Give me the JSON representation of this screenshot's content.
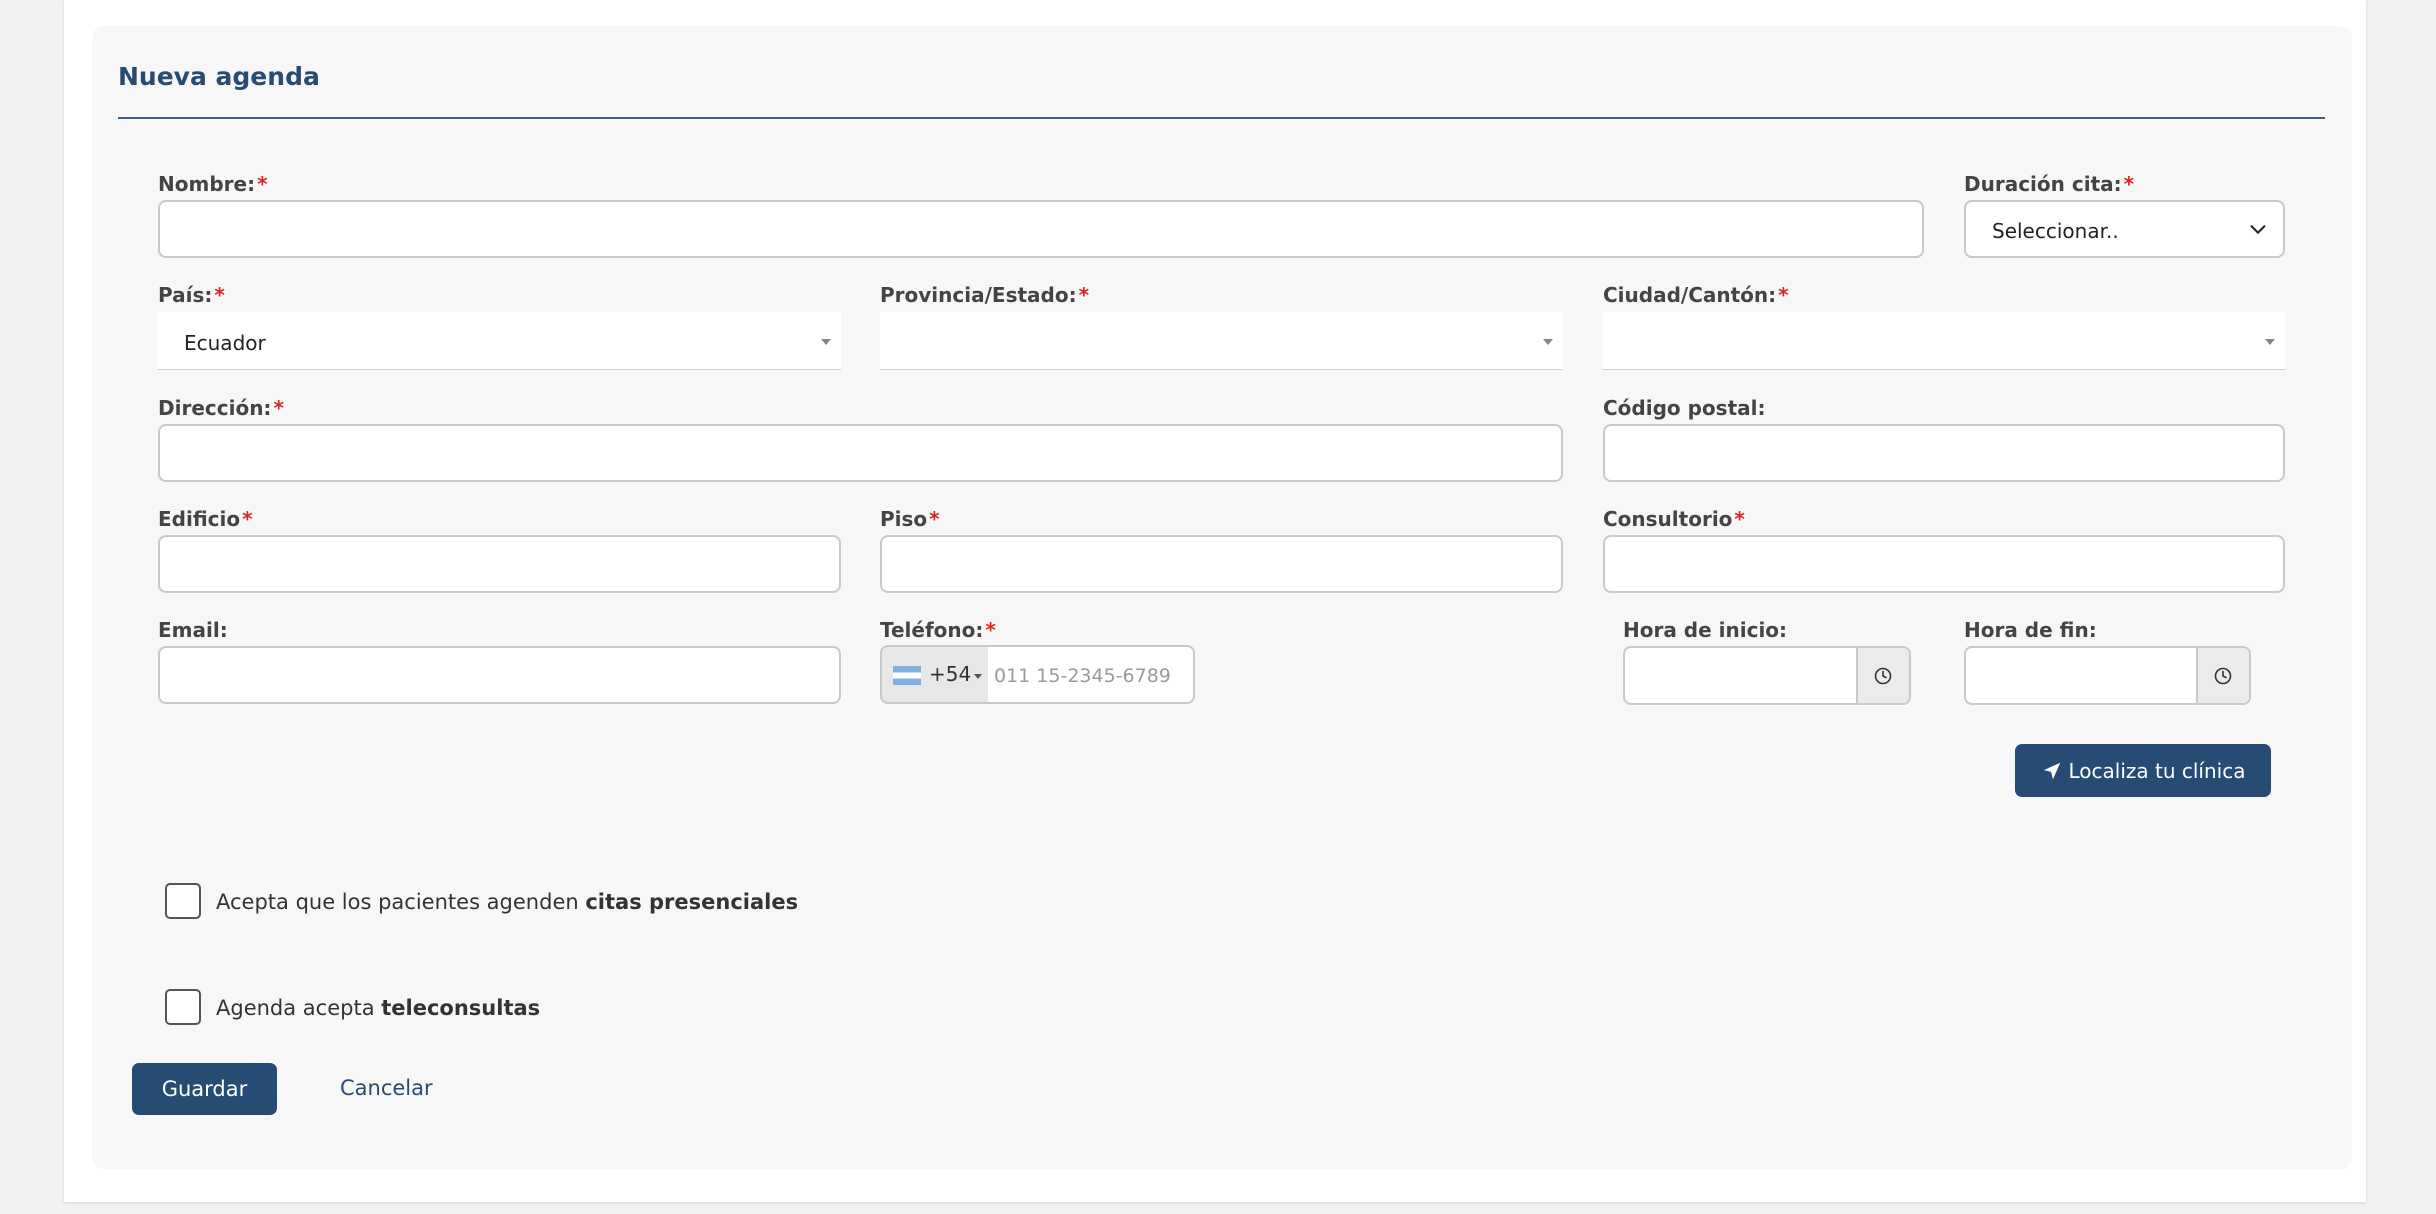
{
  "form": {
    "title": "Nueva agenda",
    "required_mark": "*",
    "fields": {
      "nombre": {
        "label": "Nombre:",
        "value": ""
      },
      "duracion": {
        "label": "Duración cita:",
        "selected": "Seleccionar.."
      },
      "pais": {
        "label": "País:",
        "selected": "Ecuador"
      },
      "provincia": {
        "label": "Provincia/Estado:",
        "selected": ""
      },
      "ciudad": {
        "label": "Ciudad/Cantón:",
        "selected": ""
      },
      "direccion": {
        "label": "Dirección:",
        "value": ""
      },
      "codigo_postal": {
        "label": "Código postal:",
        "value": ""
      },
      "edificio": {
        "label": "Edificio",
        "value": ""
      },
      "piso": {
        "label": "Piso",
        "value": ""
      },
      "consultorio": {
        "label": "Consultorio",
        "value": ""
      },
      "email": {
        "label": "Email:",
        "value": ""
      },
      "telefono": {
        "label": "Teléfono:",
        "dial_code": "+54",
        "country_flag": "argentina-flag-icon",
        "placeholder": "011 15-2345-6789"
      },
      "hora_inicio": {
        "label": "Hora de inicio:",
        "value": ""
      },
      "hora_fin": {
        "label": "Hora de fin:",
        "value": ""
      }
    },
    "locate_button": {
      "label": "Localiza tu clínica",
      "icon": "location-arrow-icon"
    },
    "checkboxes": {
      "presenciales": {
        "prefix": "Acepta que los pacientes agenden ",
        "bold": "citas presenciales",
        "checked": false
      },
      "teleconsultas": {
        "prefix": "Agenda acepta ",
        "bold": "teleconsultas",
        "checked": false
      }
    },
    "actions": {
      "save": "Guardar",
      "cancel": "Cancelar"
    }
  },
  "colors": {
    "primary": "#264c74",
    "required": "#e02424",
    "panel_bg": "#f7f7f7"
  }
}
